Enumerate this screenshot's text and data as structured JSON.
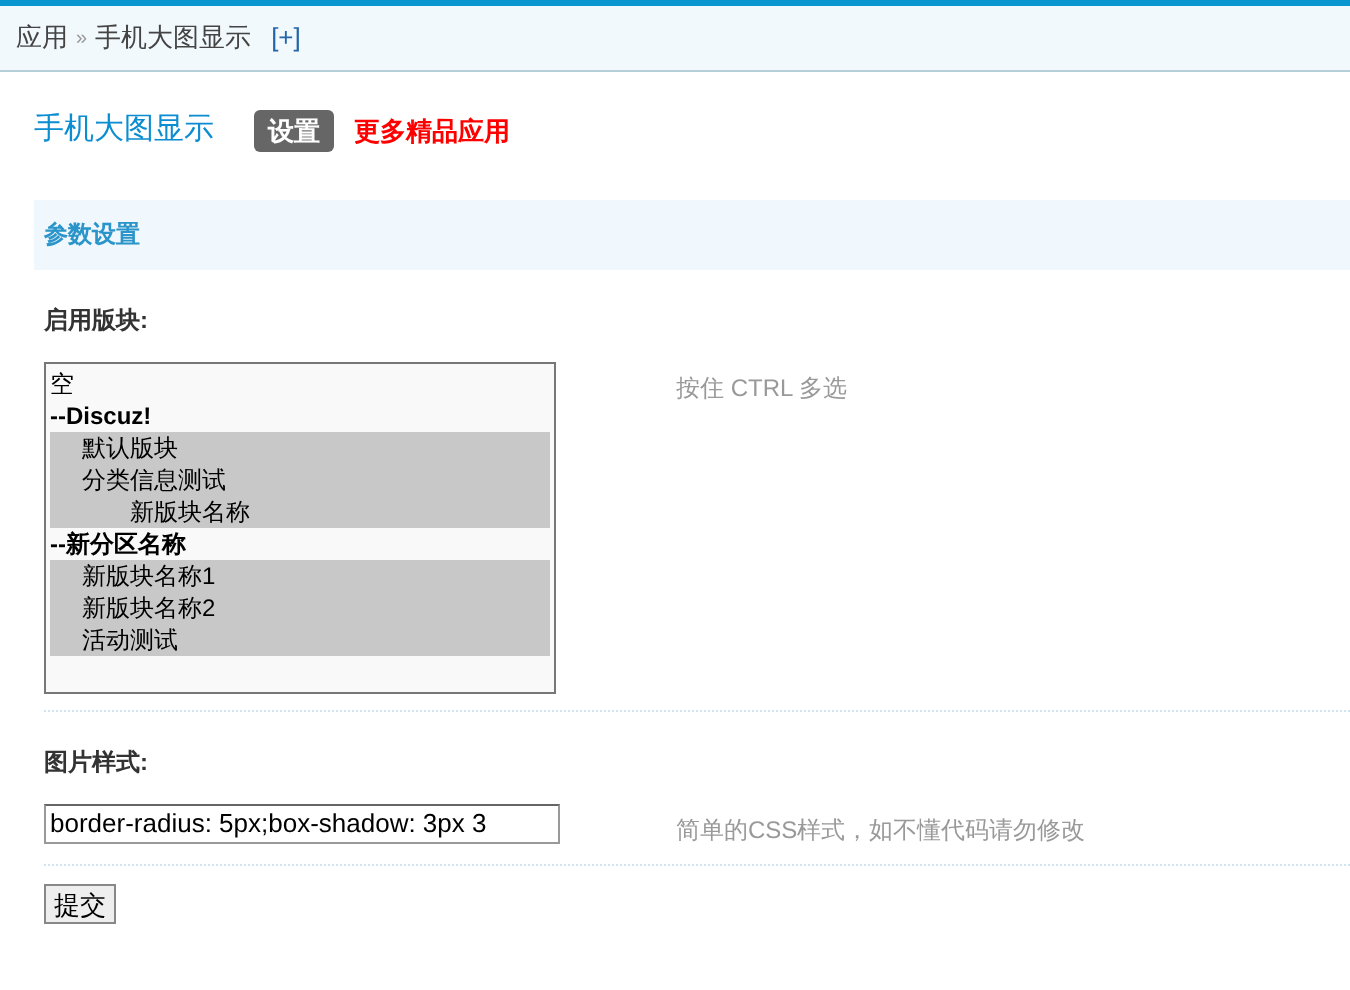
{
  "breadcrumb": {
    "items": [
      "应用",
      "手机大图显示"
    ],
    "separator": "»",
    "add_link": "[+]"
  },
  "header": {
    "title": "手机大图显示",
    "tabs": [
      {
        "label": "设置",
        "selected": true
      }
    ],
    "promo_link": "更多精品应用"
  },
  "section": {
    "title": "参数设置"
  },
  "fields": [
    {
      "kind": "multiselect",
      "label": "启用版块:",
      "hint": "按住 CTRL 多选",
      "options": [
        {
          "kind": "option",
          "label": "空",
          "selected": false
        },
        {
          "kind": "group",
          "label": "--Discuz!",
          "children": [
            {
              "kind": "option",
              "label": "默认版块",
              "selected": true
            },
            {
              "kind": "option",
              "label": "分类信息测试",
              "selected": true,
              "children": [
                {
                  "kind": "option",
                  "label": "新版块名称",
                  "selected": true
                }
              ]
            }
          ]
        },
        {
          "kind": "group",
          "label": "--新分区名称",
          "children": [
            {
              "kind": "option",
              "label": "新版块名称1",
              "selected": true
            },
            {
              "kind": "option",
              "label": "新版块名称2",
              "selected": true
            },
            {
              "kind": "option",
              "label": "活动测试",
              "selected": true
            }
          ]
        }
      ]
    },
    {
      "kind": "text",
      "label": "图片样式:",
      "value": "border-radius: 5px;box-shadow: 3px 3",
      "hint": "简单的CSS样式，如不懂代码请勿修改"
    }
  ],
  "submit": "提交"
}
